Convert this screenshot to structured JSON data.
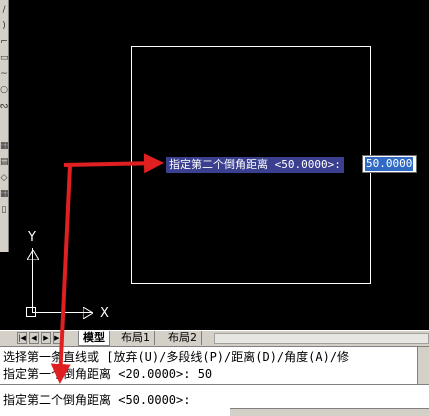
{
  "toolstrip": {
    "icons": [
      "lines",
      "arc",
      "circle-arc",
      "rectangle",
      "curve",
      "cloud",
      "point",
      "block",
      "hatch",
      "region",
      "table",
      "text"
    ]
  },
  "canvas": {
    "ucs": {
      "y_label": "Y",
      "x_label": "X"
    }
  },
  "dynamic_input": {
    "prompt": "指定第二个倒角距离 <50.0000>:",
    "value": "50.0000"
  },
  "layout_tabs": {
    "tabs": [
      {
        "label": "模型",
        "active": true
      },
      {
        "label": "布局1",
        "active": false
      },
      {
        "label": "布局2",
        "active": false
      }
    ]
  },
  "command_window": {
    "history": [
      "选择第一条直线或 [放弃(U)/多段线(P)/距离(D)/角度(A)/修",
      "指定第一个倒角距离 <20.0000>: 50"
    ],
    "current": "指定第二个倒角距离 <50.0000>:"
  },
  "colors": {
    "canvas_bg": "#000000",
    "annotation_red": "#e02020",
    "tooltip_bg": "#3a3f8f",
    "input_highlight": "#316ac5"
  }
}
